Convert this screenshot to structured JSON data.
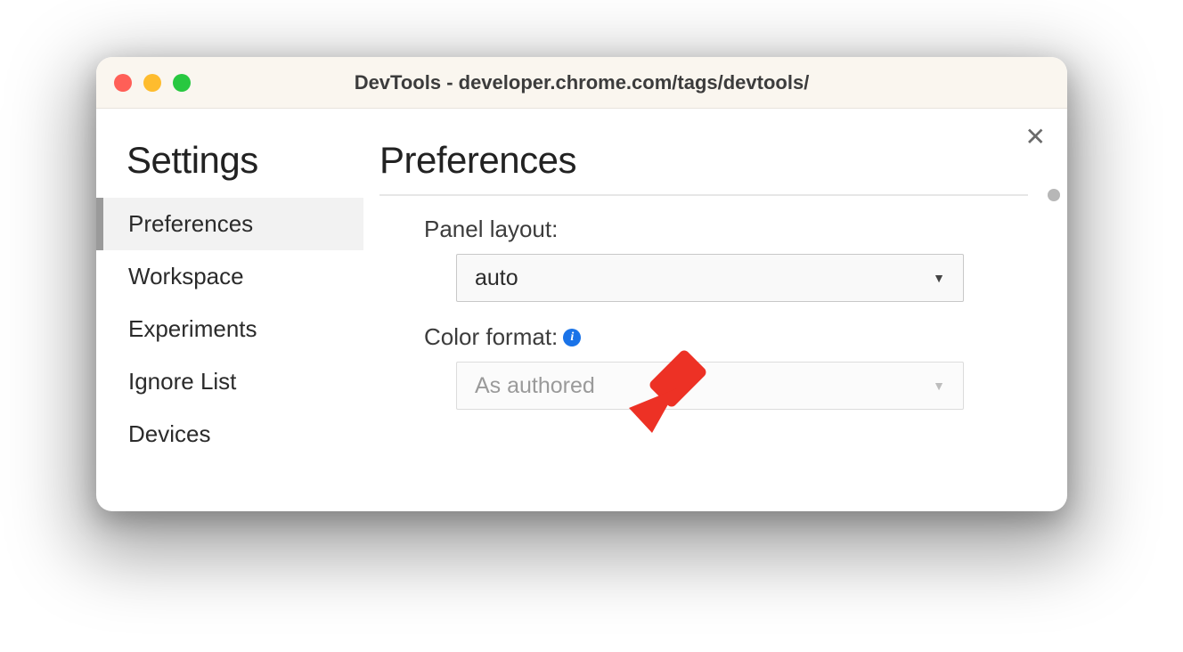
{
  "window": {
    "title": "DevTools - developer.chrome.com/tags/devtools/"
  },
  "sidebar": {
    "title": "Settings",
    "items": [
      {
        "label": "Preferences",
        "active": true
      },
      {
        "label": "Workspace",
        "active": false
      },
      {
        "label": "Experiments",
        "active": false
      },
      {
        "label": "Ignore List",
        "active": false
      },
      {
        "label": "Devices",
        "active": false
      }
    ]
  },
  "main": {
    "title": "Preferences",
    "panel_layout": {
      "label": "Panel layout:",
      "value": "auto"
    },
    "color_format": {
      "label": "Color format:",
      "value": "As authored",
      "info_icon": "i",
      "disabled": true
    }
  },
  "colors": {
    "info_badge": "#1a73e8",
    "annotation_arrow": "#ed3125"
  }
}
